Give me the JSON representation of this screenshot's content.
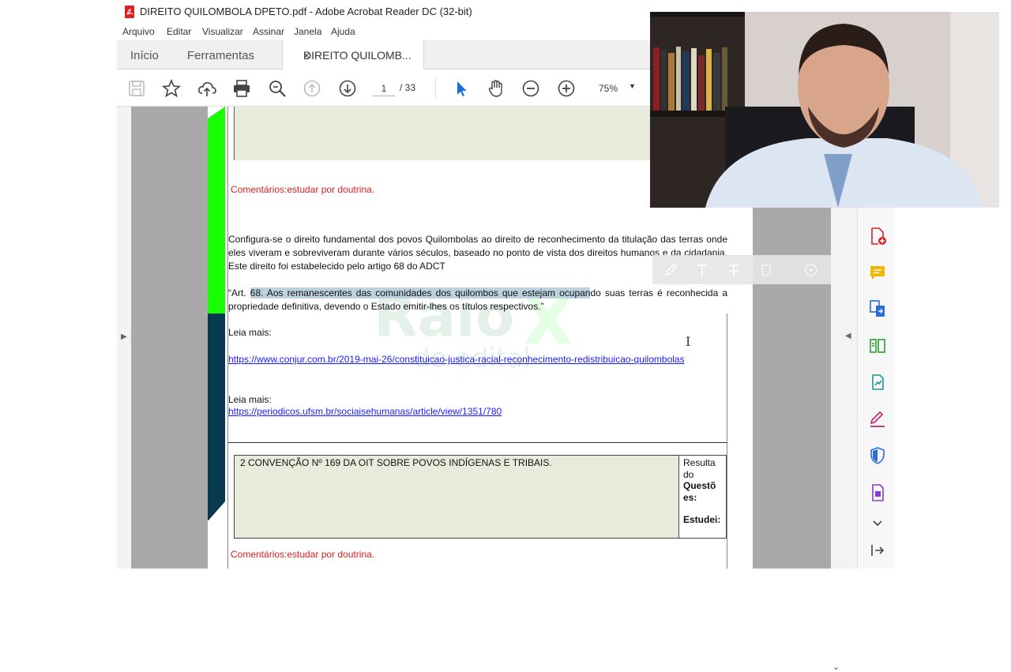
{
  "window": {
    "title": "DIREITO QUILOMBOLA DPETO.pdf - Adobe Acrobat Reader DC (32-bit)"
  },
  "menu": [
    "Arquivo",
    "Editar",
    "Visualizar",
    "Assinar",
    "Janela",
    "Ajuda"
  ],
  "tabs": {
    "home": "Início",
    "tools": "Ferramentas",
    "document": "DIREITO QUILOMB...",
    "close": "×"
  },
  "toolbar": {
    "page_current": "1",
    "page_total": "/ 33",
    "zoom": "75%",
    "zoom_caret": "▼"
  },
  "document": {
    "comment_1": "Comentários:estudar por doutrina.",
    "paragraph_1": "Configura-se o direito fundamental dos povos Quilombolas ao direito de reconhecimento da titulação das terras onde eles viveram e sobreviveram durante vários séculos, baseado no ponto de vista dos direitos humanos e da cidadania. Este direito foi estabelecido pelo artigo 68 do ADCT",
    "quote_prefix": "“Art. ",
    "quote_highlight": "68. Aos remanescentes das comunidades dos quilombos que estejam ocupan",
    "quote_rest": "do suas terras é reconhecida a propriedade definitiva, devendo o Estado emitir-lhes os títulos respectivos.”",
    "read_more_1": "Leia mais:",
    "link_1": "https://www.conjur.com.br/2019-mai-26/constituicao-justica-racial-reconhecimento-redistribuicao-quilombolas",
    "read_more_2": "Leia mais:",
    "link_2": "https://periodicos.ufsm.br/sociaisehumanas/article/view/1351/780",
    "section_title": "2 CONVENÇÃO Nº 169 DA OIT SOBRE POVOS INDÍGENAS E TRIBAIS.",
    "result_label_1": "Resulta",
    "result_label_2": "do",
    "result_label_3": "Questõ",
    "result_label_4": "es:",
    "studied_label": "Estudei:",
    "comment_2": "Comentários:estudar por doutrina."
  },
  "colors": {
    "green_bar": "#19ff00",
    "teal_bar": "#073a4f",
    "comment": "#e02020",
    "link": "#1a1aff",
    "highlight": "#bcd3df"
  },
  "icons": {
    "toolbar": [
      "save-icon",
      "star-icon",
      "cloud-upload-icon",
      "print-icon",
      "zoom-search-icon",
      "page-up-icon",
      "page-down-icon",
      "select-cursor-icon",
      "hand-icon",
      "zoom-out-icon",
      "zoom-in-icon"
    ],
    "right_panel": [
      "create-pdf-icon",
      "comment-icon",
      "export-pdf-icon",
      "organize-pages-icon",
      "edit-pdf-icon",
      "fill-sign-icon",
      "protect-icon",
      "more-tools-icon",
      "expand-icon",
      "exit-icon"
    ]
  }
}
